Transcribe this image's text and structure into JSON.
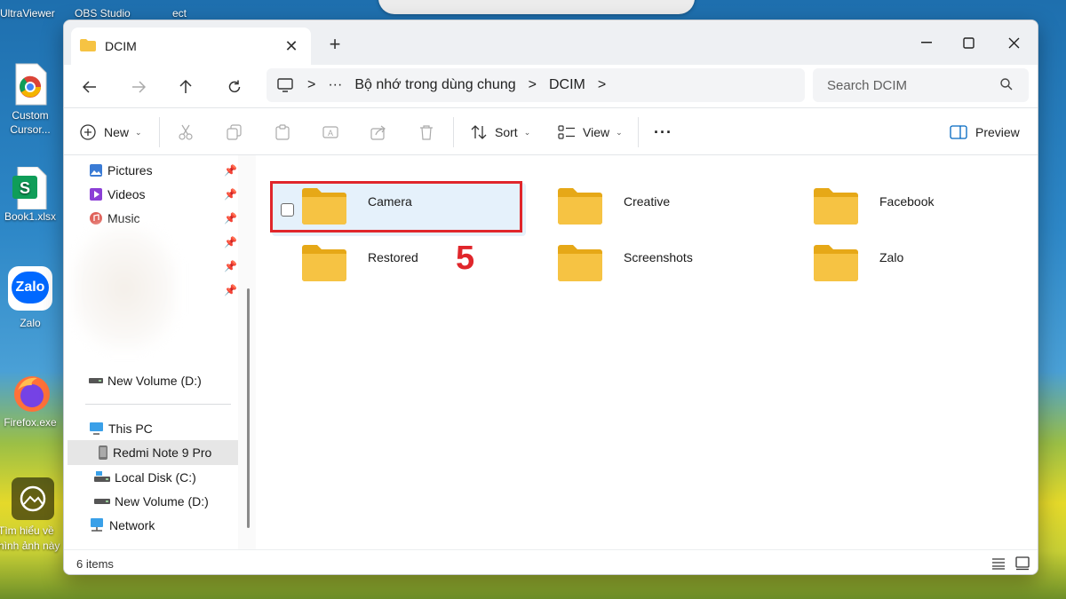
{
  "desktop": {
    "top_labels": [
      "UltraViewer",
      "OBS Studio",
      "ect"
    ],
    "icons": [
      {
        "label": "Custom Cursor...",
        "icon": "chrome-icon"
      },
      {
        "label": "Book1.xlsx",
        "icon": "sheets-icon"
      },
      {
        "label": "Zalo",
        "icon": "zalo-icon"
      },
      {
        "label": "Firefox.exe",
        "icon": "firefox-icon"
      },
      {
        "label": "Tìm hiểu về hình ảnh này",
        "icon": "spotlight-icon"
      }
    ],
    "zalo_text": "Zalo"
  },
  "window": {
    "tab_title": "DCIM",
    "new_tab_label": "+"
  },
  "address": {
    "more": "···",
    "segments": [
      "Bộ nhớ trong dùng chung",
      "DCIM"
    ],
    "separator": ">"
  },
  "search": {
    "placeholder": "Search DCIM"
  },
  "toolbar": {
    "new_label": "New",
    "sort_label": "Sort",
    "view_label": "View",
    "more_label": "···",
    "preview_label": "Preview"
  },
  "sidebar": {
    "quick_access": [
      {
        "label": "Pictures",
        "icon": "pictures-icon"
      },
      {
        "label": "Videos",
        "icon": "videos-icon"
      },
      {
        "label": "Music",
        "icon": "music-icon"
      }
    ],
    "pinned_drive": "New Volume (D:)",
    "this_pc": "This PC",
    "devices": [
      {
        "label": "Redmi Note 9 Pro",
        "icon": "phone-icon",
        "selected": true
      },
      {
        "label": "Local Disk (C:)",
        "icon": "local-disk-icon"
      },
      {
        "label": "New Volume (D:)",
        "icon": "drive-icon"
      }
    ],
    "network": "Network"
  },
  "folders": [
    {
      "name": "Camera",
      "selected": true
    },
    {
      "name": "Creative"
    },
    {
      "name": "Facebook"
    },
    {
      "name": "Restored"
    },
    {
      "name": "Screenshots"
    },
    {
      "name": "Zalo"
    }
  ],
  "annotation": {
    "step_number": "5",
    "color": "#e0262b"
  },
  "status": {
    "item_count": "6 items"
  },
  "colors": {
    "folder_yellow": "#f6c343",
    "selection_bg": "#e5f1fb",
    "accent_blue": "#0067c0"
  }
}
